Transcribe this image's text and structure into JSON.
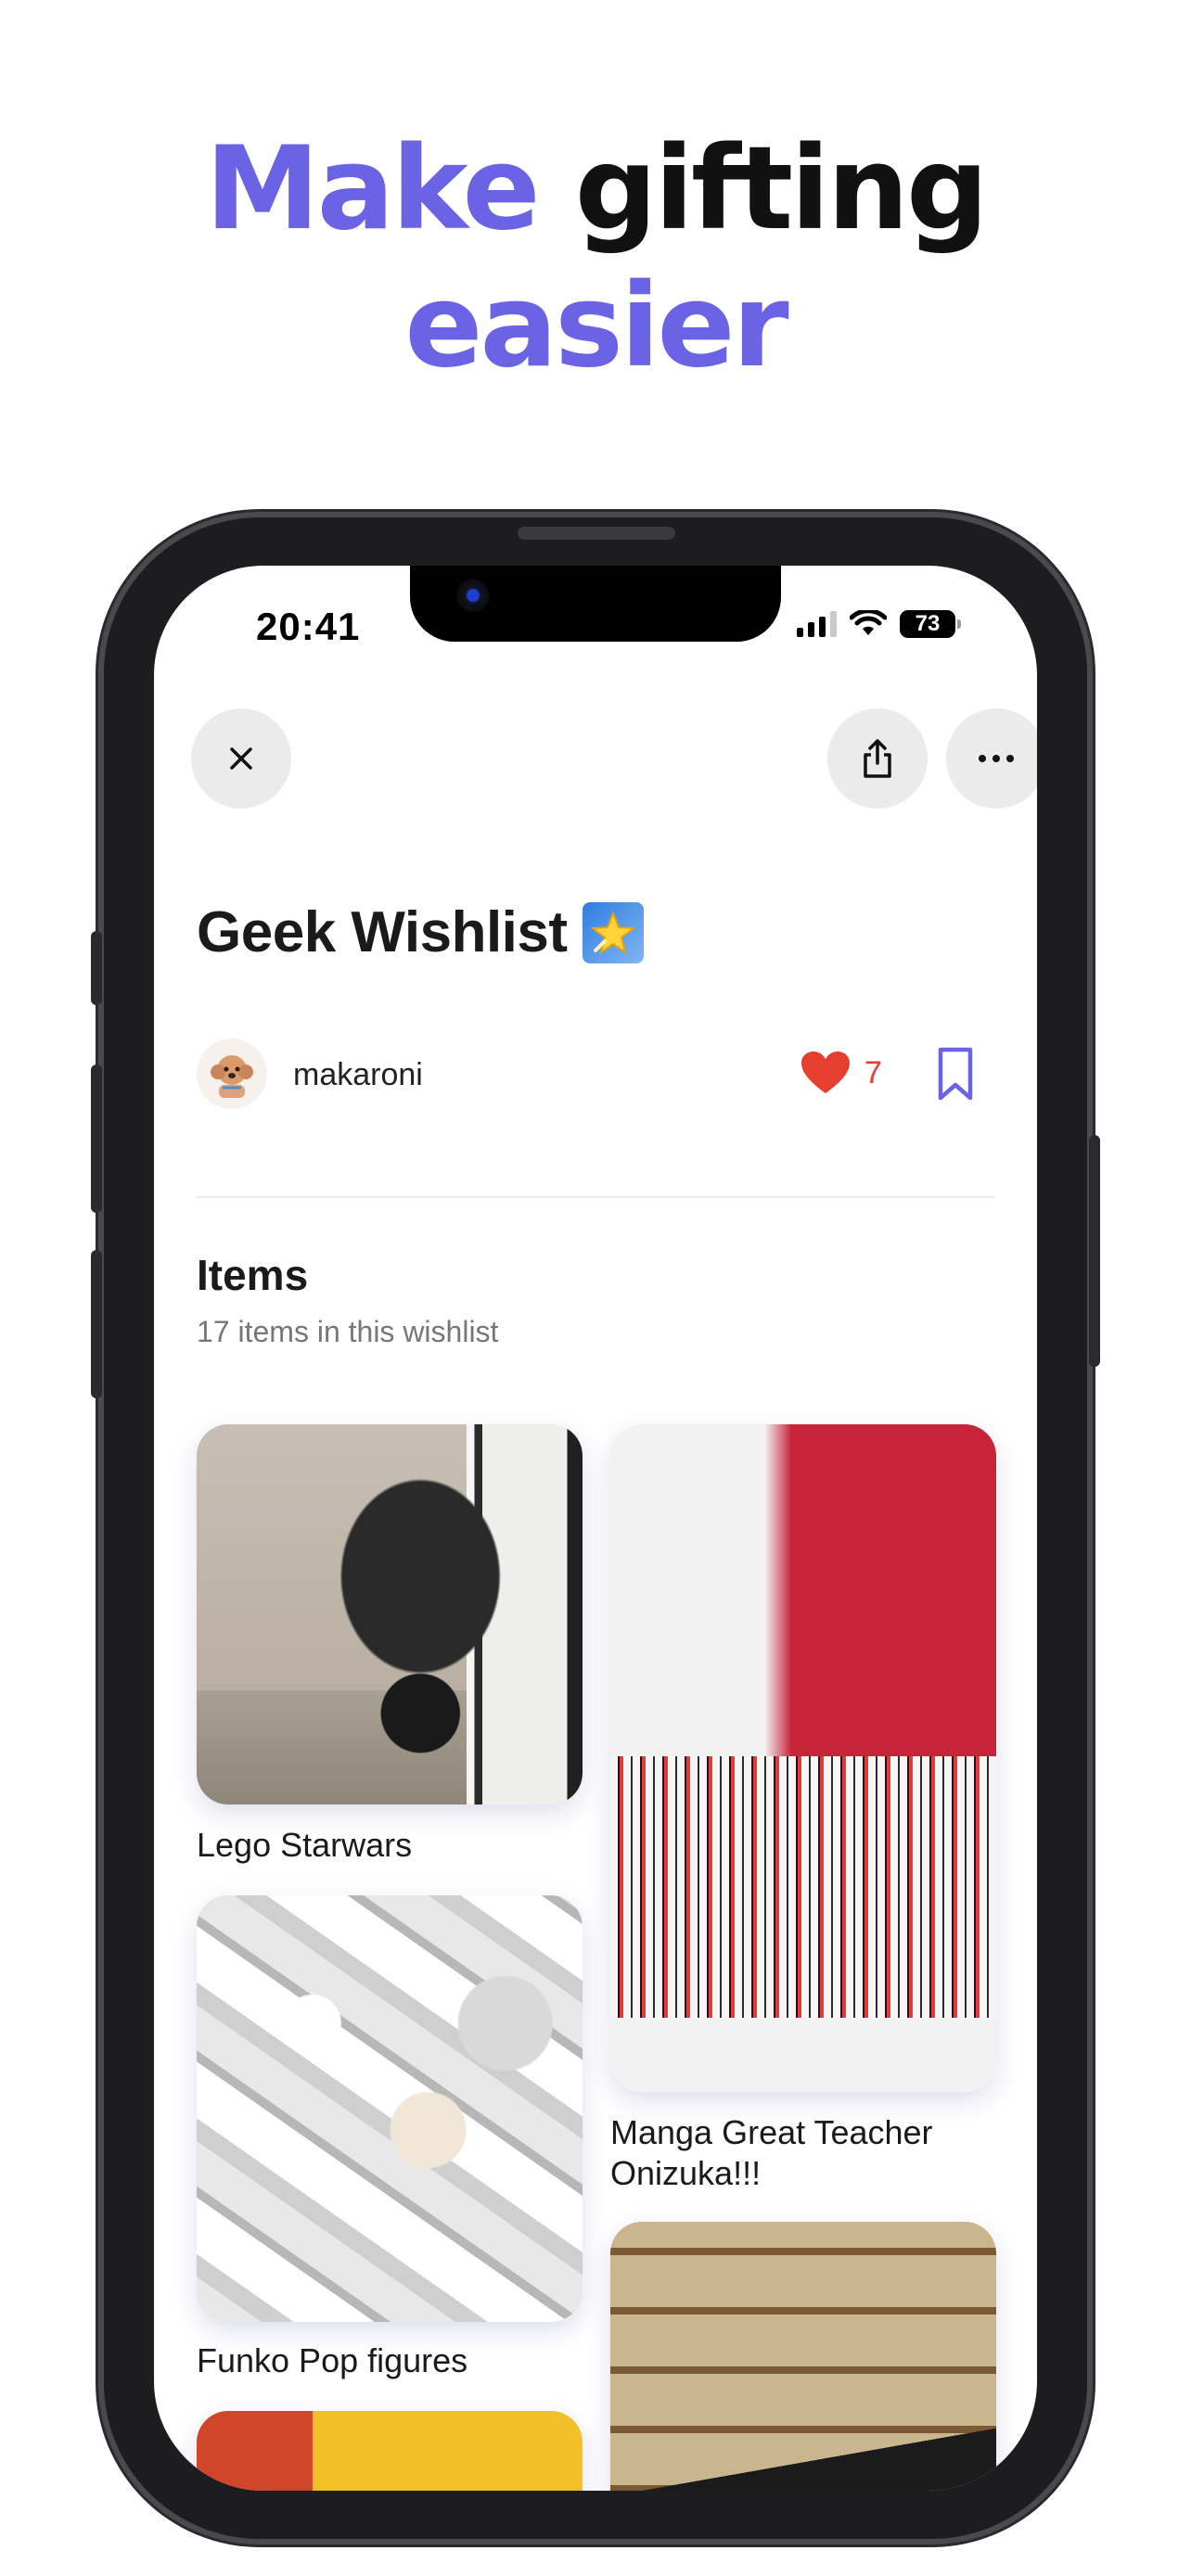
{
  "headline": {
    "line1_accent": "Make",
    "line1_dark": "gifting",
    "line2_accent": "easier"
  },
  "status_bar": {
    "time": "20:41",
    "battery": "73"
  },
  "wishlist": {
    "title": "Geek Wishlist",
    "author": "makaroni",
    "likes": "7",
    "items_heading": "Items",
    "items_subtitle": "17 items in this wishlist"
  },
  "items": [
    {
      "name": "Lego Starwars"
    },
    {
      "name": "Manga Great Teacher Onizuka!!!"
    },
    {
      "name": "Funko Pop figures"
    }
  ],
  "colors": {
    "accent": "#6b63e6",
    "heart": "#e5402f",
    "bookmark": "#6b63e6"
  },
  "icons": [
    "close-icon",
    "share-icon",
    "more-icon",
    "heart-icon",
    "bookmark-icon",
    "star-emoji-icon"
  ]
}
